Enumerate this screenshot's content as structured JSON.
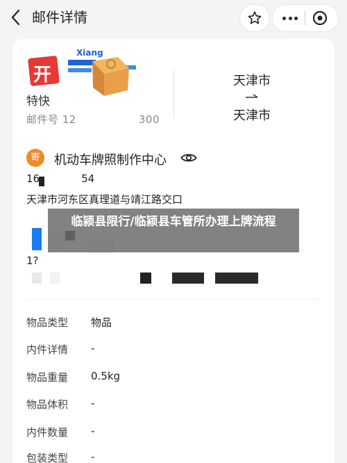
{
  "header": {
    "title": "邮件详情",
    "back_icon": "chevron-left-icon",
    "star_icon": "star-icon",
    "more_icon": "more-dots-icon",
    "target_icon": "target-icon"
  },
  "courier": {
    "name": "特快",
    "tracking_label": "邮件号 12",
    "tracking_tail": "300",
    "logo_text": "Xiang"
  },
  "route": {
    "from": "天津市",
    "to": "天津市"
  },
  "sender": {
    "badge": "寄",
    "name": "机动车牌照制作中心",
    "phone_start": "16",
    "phone_end": "54",
    "address": "天津市河东区真理道与靖江路交口"
  },
  "recipient": {
    "number_start": "1?"
  },
  "banner": {
    "text": "临颍县限行/临颍县车管所办理上牌流程"
  },
  "details": [
    {
      "label": "物品类型",
      "value": "物品"
    },
    {
      "label": "内件详情",
      "value": "-"
    },
    {
      "label": "物品重量",
      "value": "0.5kg"
    },
    {
      "label": "物品体积",
      "value": "-"
    },
    {
      "label": "内件数量",
      "value": "-"
    },
    {
      "label": "包装类型",
      "value": "-"
    }
  ],
  "colors": {
    "badge": "#f08a24",
    "background": "#f3f4f6"
  }
}
